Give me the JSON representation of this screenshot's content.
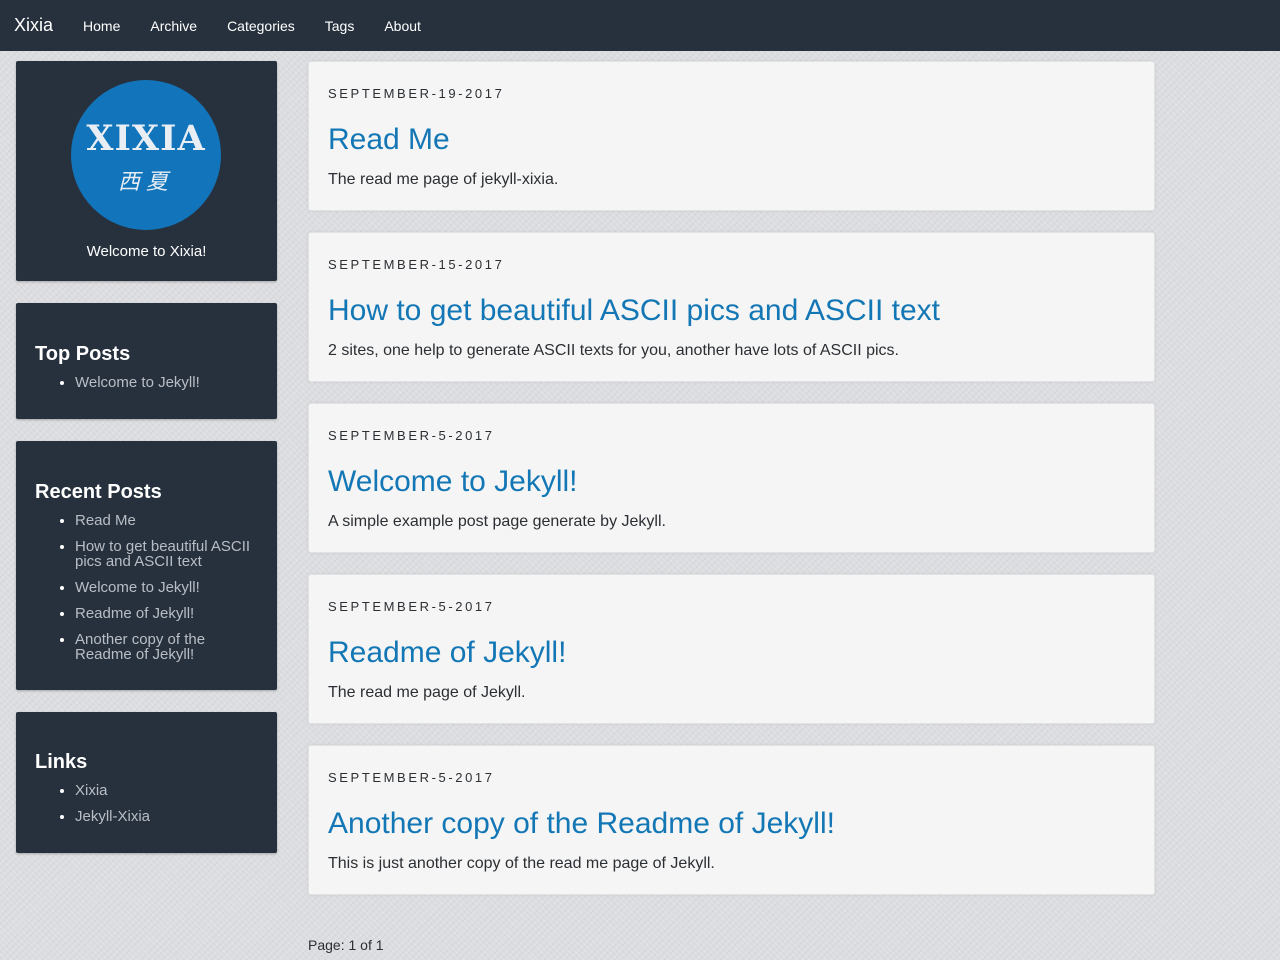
{
  "navbar": {
    "brand": "Xixia",
    "links": [
      "Home",
      "Archive",
      "Categories",
      "Tags",
      "About"
    ]
  },
  "profile": {
    "logo_text": "XIXIA",
    "logo_subtext": "西夏",
    "welcome": "Welcome to Xixia!"
  },
  "top_posts": {
    "title": "Top Posts",
    "items": [
      "Welcome to Jekyll!"
    ]
  },
  "recent_posts": {
    "title": "Recent Posts",
    "items": [
      "Read Me",
      "How to get beautiful ASCII pics and ASCII text",
      "Welcome to Jekyll!",
      "Readme of Jekyll!",
      "Another copy of the Readme of Jekyll!"
    ]
  },
  "links": {
    "title": "Links",
    "items": [
      "Xixia",
      "Jekyll-Xixia"
    ]
  },
  "posts": [
    {
      "date": "SEPTEMBER-19-2017",
      "title": "Read Me",
      "excerpt": "The read me page of jekyll-xixia."
    },
    {
      "date": "SEPTEMBER-15-2017",
      "title": "How to get beautiful ASCII pics and ASCII text",
      "excerpt": "2 sites, one help to generate ASCII texts for you, another have lots of ASCII pics."
    },
    {
      "date": "SEPTEMBER-5-2017",
      "title": "Welcome to Jekyll!",
      "excerpt": "A simple example post page generate by Jekyll."
    },
    {
      "date": "SEPTEMBER-5-2017",
      "title": "Readme of Jekyll!",
      "excerpt": "The read me page of Jekyll."
    },
    {
      "date": "SEPTEMBER-5-2017",
      "title": "Another copy of the Readme of Jekyll!",
      "excerpt": "This is just another copy of the read me page of Jekyll."
    }
  ],
  "pagination": "Page: 1 of 1",
  "colors": {
    "navbar_bg": "#27313d",
    "panel_bg": "#27313d",
    "link_blue": "#1477b5",
    "logo_blue": "#1275bb"
  }
}
